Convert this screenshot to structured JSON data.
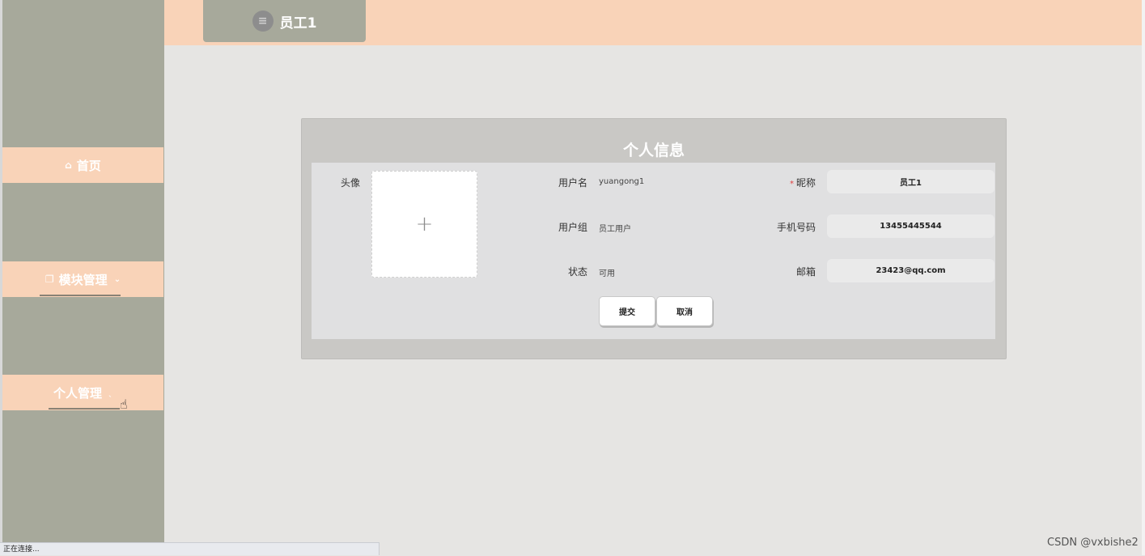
{
  "header": {
    "username": "员工1"
  },
  "sidebar": {
    "items": [
      {
        "label": "首页",
        "icon": "home-icon"
      },
      {
        "label": "模块管理",
        "icon": "copy-icon"
      },
      {
        "label": "个人管理"
      }
    ]
  },
  "panel": {
    "title": "个人信息",
    "avatar_label": "头像",
    "upload_glyph": "+",
    "username_label": "用户名",
    "username_value": "yuangong1",
    "group_label": "用户组",
    "group_value": "员工用户",
    "status_label": "状态",
    "status_value": "可用",
    "nickname_required": "*",
    "nickname_label": "昵称",
    "nickname_value": "员工1",
    "phone_label": "手机号码",
    "phone_value": "13455445544",
    "email_label": "邮箱",
    "email_value": "23423@qq.com",
    "submit_label": "提交",
    "cancel_label": "取消"
  },
  "statusbar": {
    "text": "正在连接..."
  },
  "watermark": "CSDN @vxbishe2",
  "colors": {
    "sidebar": "#a7a99b",
    "accent": "#f9d3b8",
    "background": "#e6e5e3"
  }
}
